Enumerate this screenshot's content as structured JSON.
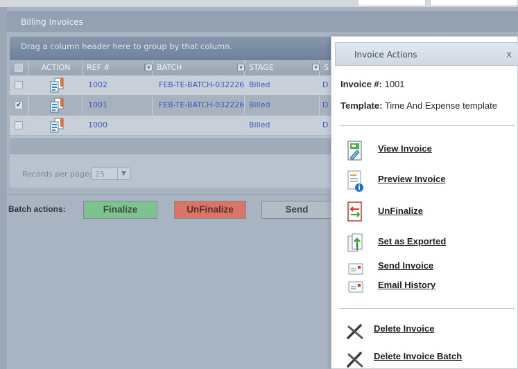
{
  "panel": {
    "title": "Billing Invoices"
  },
  "grid": {
    "group_hint": "Drag a column header here to group by that column.",
    "columns": [
      "ACTION",
      "REF #",
      "BATCH",
      "STAGE",
      "S"
    ],
    "rows": [
      {
        "ref": "1002",
        "batch": "FEB-TE-BATCH-032226",
        "stage": "Billed",
        "s": "D",
        "checked": false
      },
      {
        "ref": "1001",
        "batch": "FEB-TE-BATCH-032226",
        "stage": "Billed",
        "s": "D",
        "checked": true
      },
      {
        "ref": "1000",
        "batch": "",
        "stage": "Billed",
        "s": "D",
        "checked": false
      }
    ],
    "records_per_page_label": "Records per page:",
    "records_per_page_value": "25",
    "checkmark": "✔"
  },
  "batch_actions": {
    "label": "Batch actions:",
    "finalize": "Finalize",
    "unfinalize": "UnFinalize",
    "send": "Send"
  },
  "modal": {
    "title": "Invoice Actions",
    "close": "x",
    "invoice_label": "Invoice #:",
    "invoice_value": "1001",
    "template_label": "Template:",
    "template_value": "Time And Expense template",
    "actions": {
      "view": "View Invoice",
      "preview": "Preview Invoice",
      "unfinalize": "UnFinalize",
      "exported": "Set as Exported",
      "send": "Send Invoice",
      "email_history": "Email History",
      "delete": "Delete Invoice",
      "delete_batch": "Delete Invoice Batch"
    }
  },
  "colors": {
    "finalize": "#7dc38e",
    "unfinalize": "#d97566",
    "highlight": "#f3f331",
    "link": "#3b59c0"
  }
}
